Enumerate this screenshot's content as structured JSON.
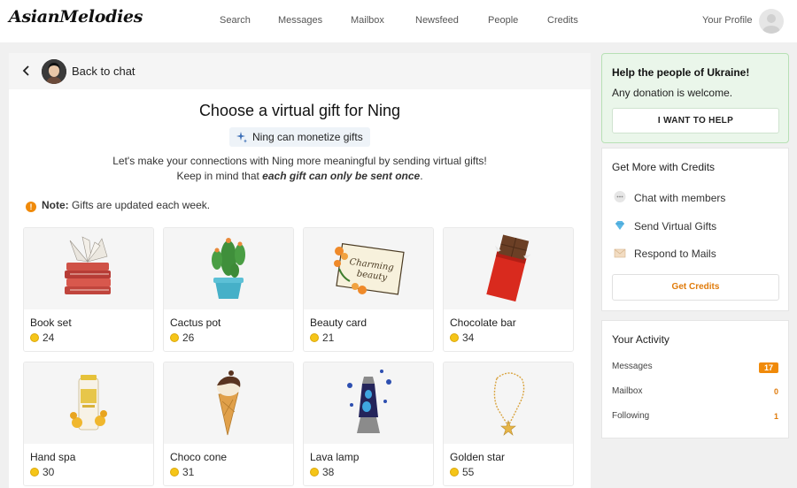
{
  "header": {
    "logo": "AsianMelodies",
    "nav": [
      "Search",
      "Messages",
      "Mailbox",
      "Newsfeed",
      "People",
      "Credits"
    ],
    "profile_label": "Your Profile"
  },
  "back_bar": {
    "label": "Back to chat"
  },
  "main": {
    "title": "Choose a virtual gift for Ning",
    "monetize_chip": "Ning can monetize gifts",
    "intro_line1": "Let's make your connections with Ning more meaningful by sending virtual gifts!",
    "intro_line2_prefix": "Keep in mind that ",
    "intro_line2_emphasis": "each gift can only be sent once",
    "intro_line2_suffix": ".",
    "note_label": "Note:",
    "note_text": " Gifts are updated each week."
  },
  "gifts": [
    {
      "name": "Book set",
      "price": "24",
      "icon": "book-set"
    },
    {
      "name": "Cactus pot",
      "price": "26",
      "icon": "cactus-pot"
    },
    {
      "name": "Beauty card",
      "price": "21",
      "icon": "beauty-card"
    },
    {
      "name": "Chocolate bar",
      "price": "34",
      "icon": "chocolate-bar"
    },
    {
      "name": "Hand spa",
      "price": "30",
      "icon": "hand-spa"
    },
    {
      "name": "Choco cone",
      "price": "31",
      "icon": "choco-cone"
    },
    {
      "name": "Lava lamp",
      "price": "38",
      "icon": "lava-lamp"
    },
    {
      "name": "Golden star",
      "price": "55",
      "icon": "golden-star"
    }
  ],
  "beauty_card_text": [
    "Charming",
    "beauty"
  ],
  "ukraine": {
    "title": "Help the people of Ukraine!",
    "text": "Any donation is welcome.",
    "button": "I WANT TO HELP"
  },
  "credits_box": {
    "title": "Get More with Credits",
    "benefits": [
      {
        "label": "Chat with members",
        "icon": "chat-bubble-icon"
      },
      {
        "label": "Send Virtual Gifts",
        "icon": "diamond-icon"
      },
      {
        "label": "Respond to Mails",
        "icon": "envelope-icon"
      }
    ],
    "button": "Get Credits"
  },
  "activity": {
    "title": "Your Activity",
    "rows": [
      {
        "label": "Messages",
        "value": "17"
      },
      {
        "label": "Mailbox",
        "value": "0"
      },
      {
        "label": "Following",
        "value": "1"
      }
    ]
  },
  "colors": {
    "accent_orange": "#f08a0a",
    "ukraine_bg": "#eaf6ea",
    "coin": "#f5c518"
  }
}
